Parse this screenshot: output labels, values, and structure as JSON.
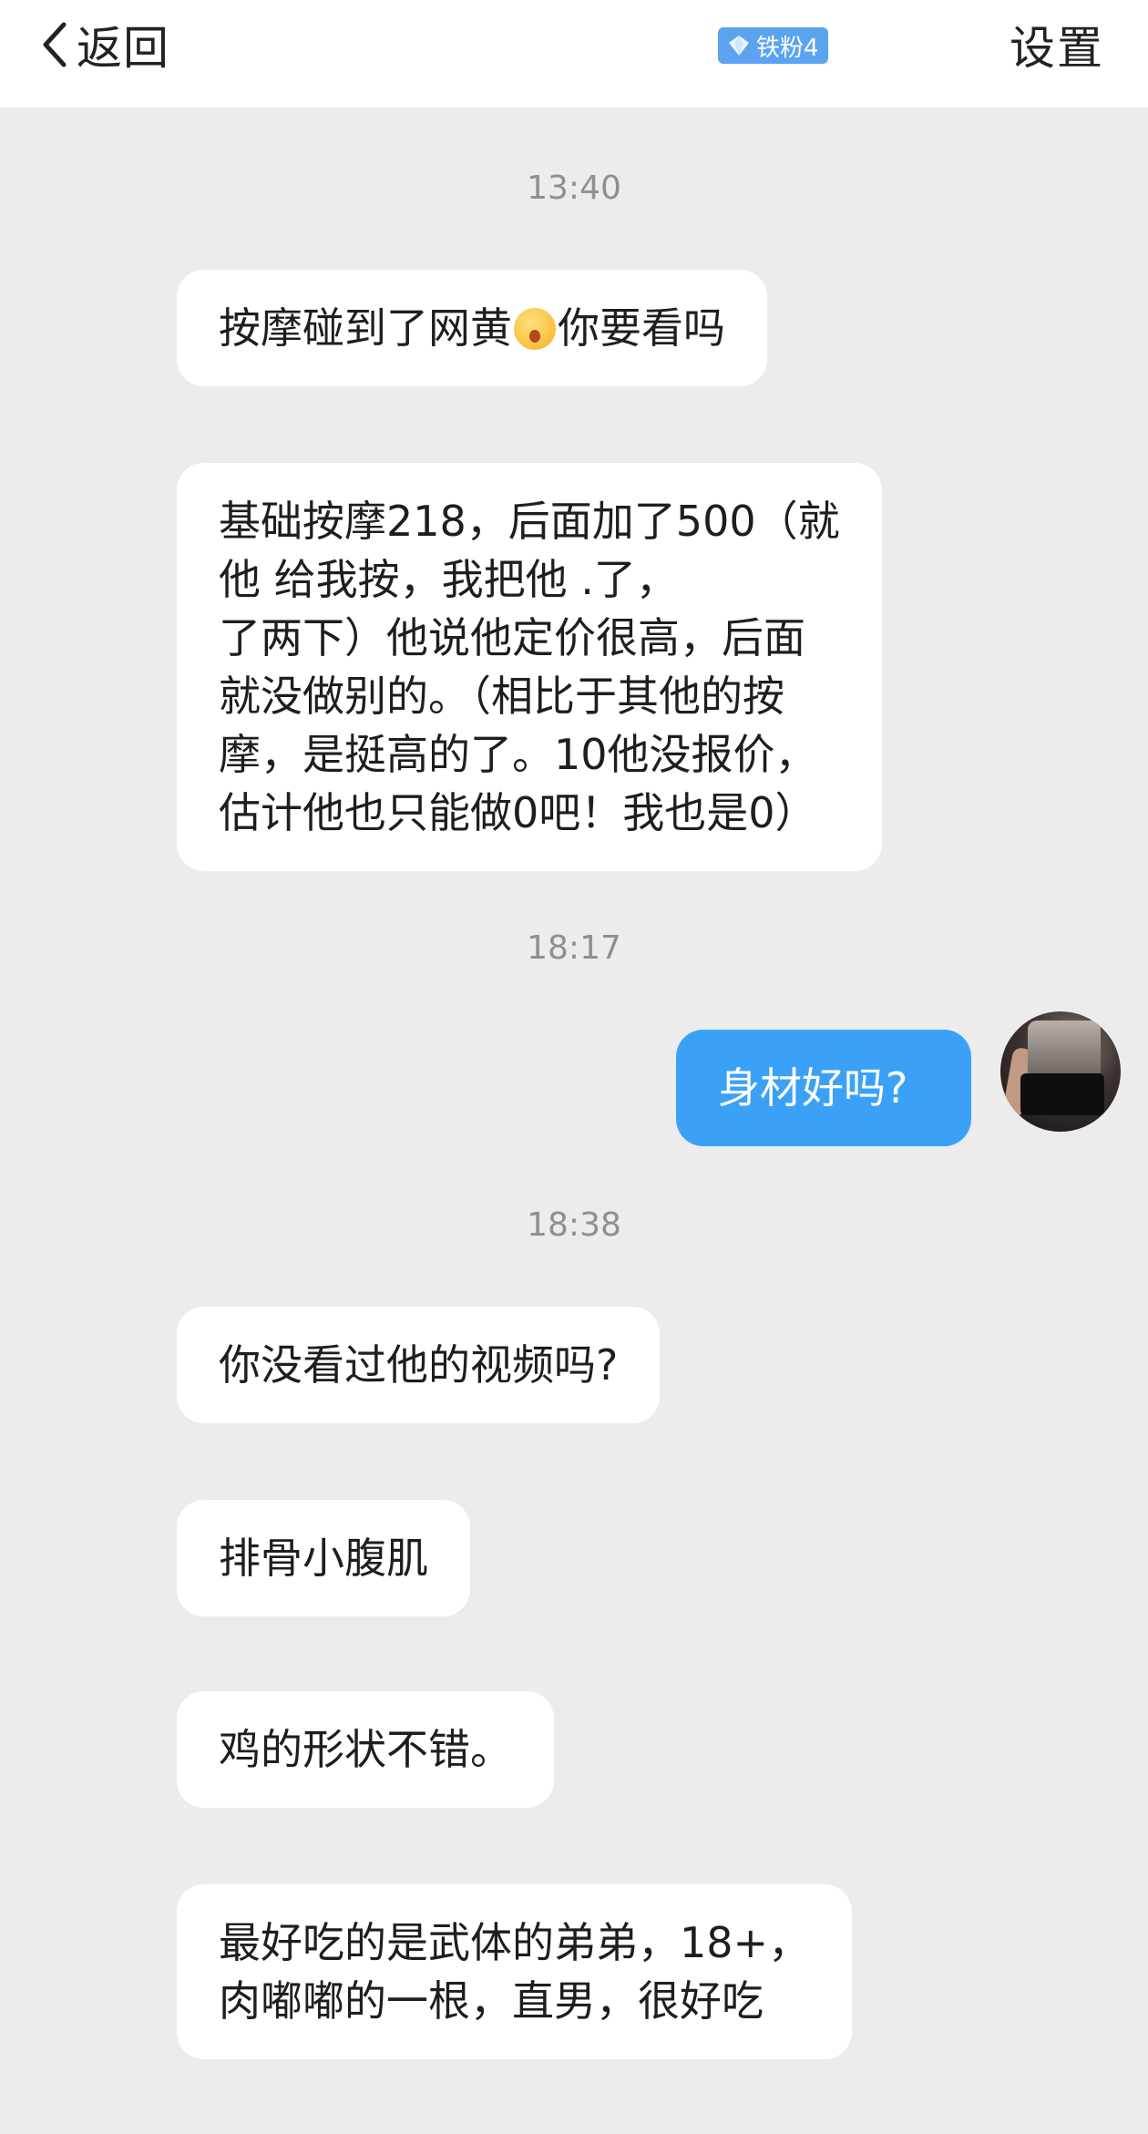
{
  "header": {
    "back_icon": "chevron-left-icon",
    "back_label": "返回",
    "badge_icon": "diamond-icon",
    "badge_label": "铁粉4",
    "settings_label": "设置"
  },
  "conversation": {
    "timestamps": [
      "13:40",
      "18:17",
      "18:38"
    ],
    "messages": [
      {
        "side": "left",
        "lines": [
          "按摩碰到了网黄",
          "你要看吗"
        ],
        "emoji": "astonished-face-emoji"
      },
      {
        "side": "left",
        "lines": [
          "基础按摩218，后面加了500（就",
          "他    给我按，我把他       .了，",
          "了两下）他说他定价很高，后面",
          "就没做别的。（相比于其他的按",
          "摩，是挺高的了。10他没报价，",
          "估计他也只能做0吧！我也是0）"
        ]
      },
      {
        "side": "right",
        "lines": [
          "身材好吗?"
        ]
      },
      {
        "side": "left",
        "lines": [
          "你没看过他的视频吗?"
        ]
      },
      {
        "side": "left",
        "lines": [
          "排骨小腹肌"
        ]
      },
      {
        "side": "left",
        "lines": [
          "鸡的形状不错。"
        ]
      },
      {
        "side": "left",
        "lines": [
          "最好吃的是武体的弟弟，18+，",
          "肉嘟嘟的一根，直男，很好吃"
        ]
      }
    ]
  },
  "colors": {
    "background": "#ececec",
    "left_bubble": "#ffffff",
    "right_bubble": "#3ba1f7",
    "timestamp": "#8f8f8f",
    "badge": "#5ba3f0"
  }
}
